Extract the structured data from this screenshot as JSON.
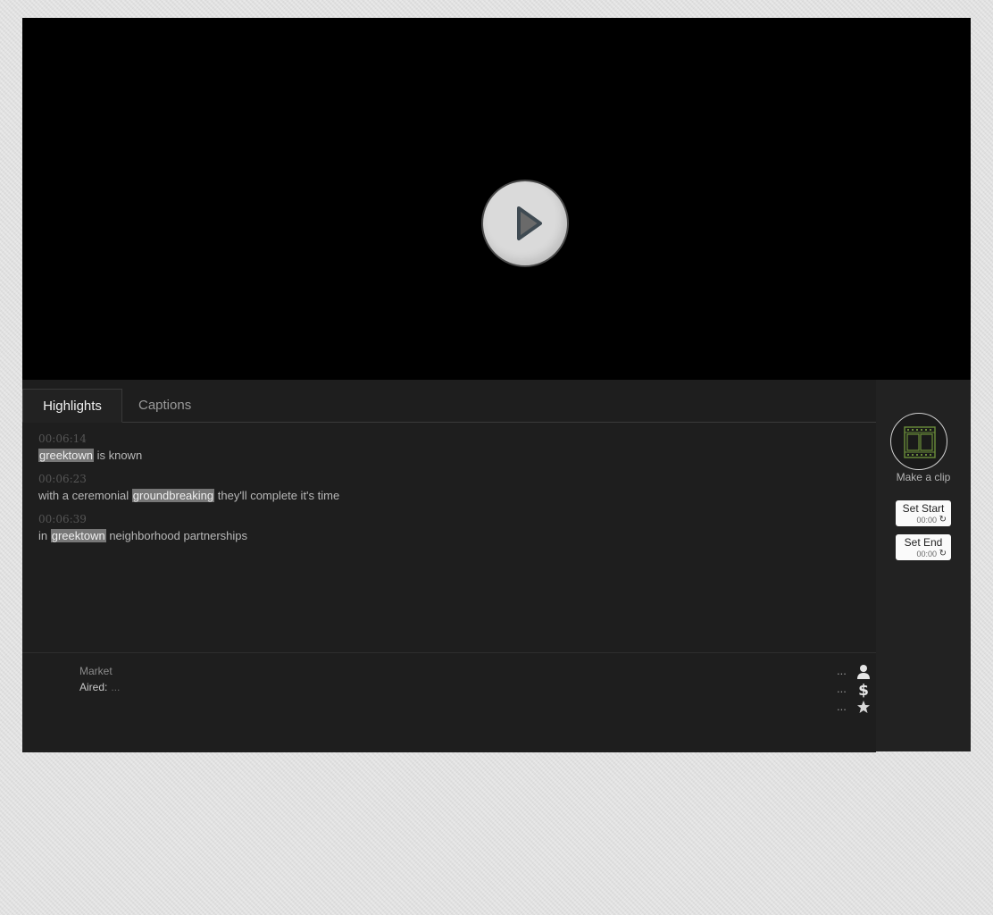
{
  "tabs": {
    "highlights": "Highlights",
    "captions": "Captions"
  },
  "captions": [
    {
      "time": "00:06:14",
      "before": "",
      "highlight": "greektown",
      "after": " is known"
    },
    {
      "time": "00:06:23",
      "before": "with a ceremonial ",
      "highlight": "groundbreaking",
      "after": " they'll complete it's time"
    },
    {
      "time": "00:06:39",
      "before": "in ",
      "highlight": "greektown",
      "after": " neighborhood partnerships"
    }
  ],
  "meta": {
    "market_label": "Market",
    "aired_label": "Aired:",
    "aired_value": "...",
    "stats": [
      {
        "value": "...",
        "icon": "person-icon"
      },
      {
        "value": "...",
        "icon": "dollar-icon"
      },
      {
        "value": "...",
        "icon": "star-icon"
      }
    ]
  },
  "clip": {
    "make_clip_label": "Make a clip",
    "set_start_label": "Set Start",
    "set_start_time": "00:00",
    "set_end_label": "Set End",
    "set_end_time": "00:00",
    "reset_glyph": "↻"
  },
  "colors": {
    "clip_icon": "#6b8e3a",
    "highlight_bg": "#777777"
  }
}
